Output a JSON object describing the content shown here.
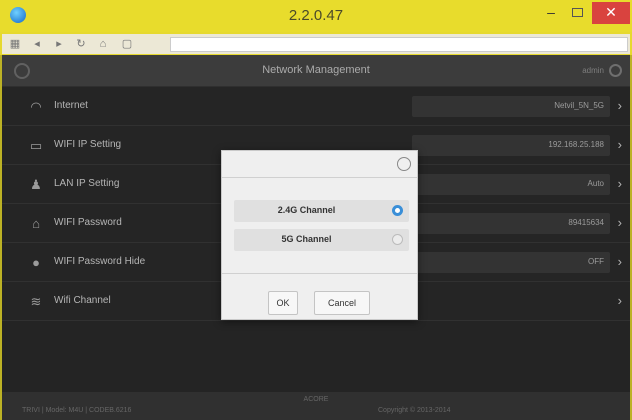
{
  "window": {
    "title": "2.2.0.47",
    "minimize": "–",
    "close": "✕"
  },
  "header": {
    "title": "Network Management",
    "user": "admin"
  },
  "settings": [
    {
      "label": "Internet",
      "value": "Netvil_5N_5G",
      "icon": "globe-wifi-icon"
    },
    {
      "label": "WIFI IP Setting",
      "value": "192.168.25.188",
      "icon": "monitor-icon"
    },
    {
      "label": "LAN IP Setting",
      "value": "Auto",
      "icon": "lan-icon"
    },
    {
      "label": "WIFI Password",
      "value": "89415634",
      "icon": "lock-house-icon"
    },
    {
      "label": "WIFI Password Hide",
      "value": "OFF",
      "icon": "toggle-icon"
    },
    {
      "label": "Wifi Channel",
      "value": "",
      "icon": "wifi-icon"
    }
  ],
  "dialog": {
    "options": [
      {
        "label": "2.4G Channel",
        "selected": true
      },
      {
        "label": "5G Channel",
        "selected": false
      }
    ],
    "ok_label": "OK",
    "cancel_label": "Cancel"
  },
  "footer": {
    "center": "ACORE",
    "left": "TRIVI | Model: M4U | CODEB.6216",
    "right": "Copyright © 2013-2014"
  },
  "colors": {
    "titlebar": "#e8dc2c",
    "close_button": "#d9433f",
    "app_background": "#2c2c2c",
    "radio_selected": "#3a8fd8"
  }
}
